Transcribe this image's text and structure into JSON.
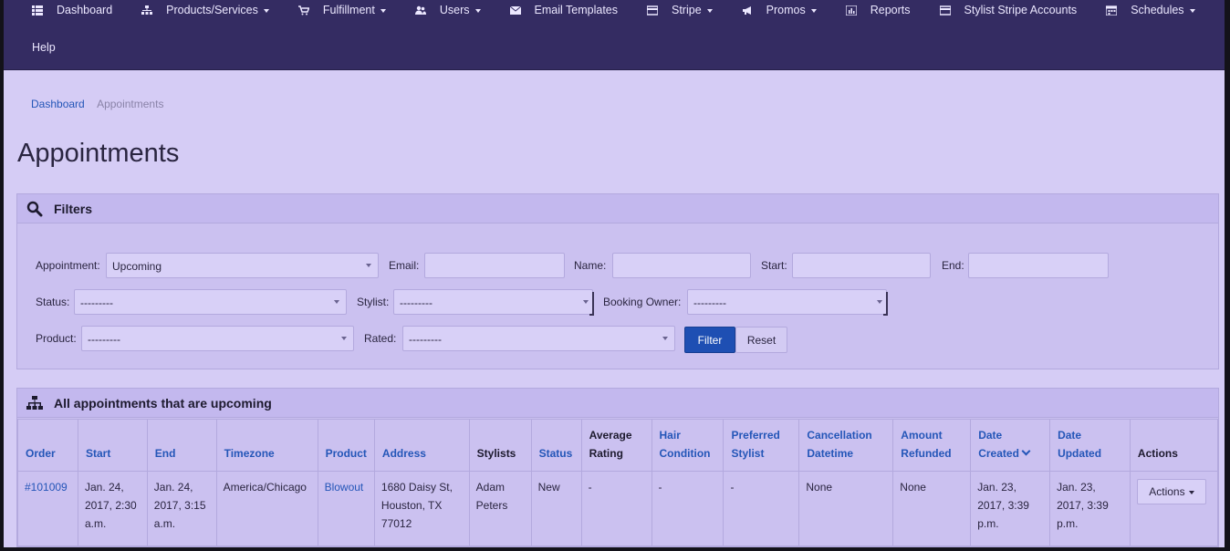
{
  "nav": {
    "items": [
      {
        "label": "Dashboard",
        "icon": "list-icon",
        "caret": false
      },
      {
        "label": "Products/Services",
        "icon": "sitemap-icon",
        "caret": true
      },
      {
        "label": "Fulfillment",
        "icon": "cart-icon",
        "caret": true
      },
      {
        "label": "Users",
        "icon": "users-icon",
        "caret": true
      },
      {
        "label": "Email Templates",
        "icon": "envelope-icon",
        "caret": false
      },
      {
        "label": "Stripe",
        "icon": "credit-card-icon",
        "caret": true
      },
      {
        "label": "Promos",
        "icon": "bullhorn-icon",
        "caret": true
      },
      {
        "label": "Reports",
        "icon": "bar-chart-icon",
        "caret": false
      },
      {
        "label": "Stylist Stripe Accounts",
        "icon": "credit-card-icon",
        "caret": false
      },
      {
        "label": "Schedules",
        "icon": "calendar-icon",
        "caret": true
      }
    ],
    "help": "Help"
  },
  "breadcrumb": {
    "home": "Dashboard",
    "current": "Appointments"
  },
  "page_title": "Appointments",
  "filters": {
    "heading": "Filters",
    "appointment_label": "Appointment:",
    "appointment_value": "Upcoming",
    "email_label": "Email:",
    "name_label": "Name:",
    "start_label": "Start:",
    "end_label": "End:",
    "status_label": "Status:",
    "status_value": "---------",
    "stylist_label": "Stylist:",
    "stylist_value": "---------",
    "booking_owner_label": "Booking Owner:",
    "booking_owner_value": "---------",
    "product_label": "Product:",
    "product_value": "---------",
    "rated_label": "Rated:",
    "rated_value": "---------",
    "filter_button": "Filter",
    "reset_button": "Reset"
  },
  "list": {
    "heading": "All appointments that are upcoming",
    "columns": [
      "Order",
      "Start",
      "End",
      "Timezone",
      "Product",
      "Address",
      "Stylists",
      "Status",
      "Average Rating",
      "Hair Condition",
      "Preferred Stylist",
      "Cancellation Datetime",
      "Amount Refunded",
      "Date Created",
      "Date Updated",
      "Actions"
    ],
    "rows": [
      {
        "order": "#101009",
        "start": "Jan. 24, 2017, 2:30 a.m.",
        "end": "Jan. 24, 2017, 3:15 a.m.",
        "timezone": "America/Chicago",
        "product": "Blowout",
        "address": "1680 Daisy St, Houston, TX 77012",
        "stylists": "Adam Peters",
        "status": "New",
        "average_rating": "-",
        "hair_condition": "-",
        "preferred_stylist": "-",
        "cancellation_datetime": "None",
        "amount_refunded": "None",
        "date_created": "Jan. 23, 2017, 3:39 p.m.",
        "date_updated": "Jan. 23, 2017, 3:39 p.m.",
        "actions": "Actions"
      }
    ]
  }
}
